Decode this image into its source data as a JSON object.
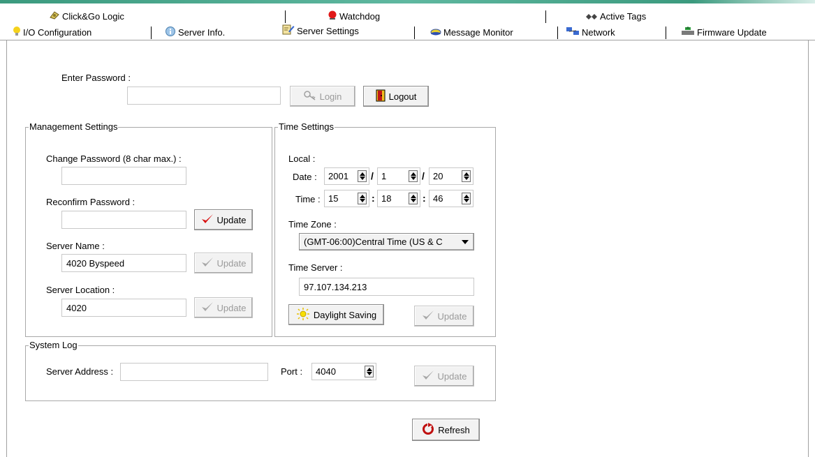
{
  "tabs_row1": [
    {
      "label": "Click&Go Logic",
      "icon": "logic-icon"
    },
    {
      "label": "Watchdog",
      "icon": "watchdog-icon"
    },
    {
      "label": "Active Tags",
      "icon": "active-tags-icon"
    }
  ],
  "tabs_row2": [
    {
      "label": "I/O Configuration",
      "icon": "lightbulb-icon"
    },
    {
      "label": "Server Info.",
      "icon": "info-icon"
    },
    {
      "label": "Server Settings",
      "icon": "settings-pencil-icon"
    },
    {
      "label": "Message Monitor",
      "icon": "message-icon"
    },
    {
      "label": "Network",
      "icon": "network-icon"
    },
    {
      "label": "Firmware Update",
      "icon": "firmware-icon"
    }
  ],
  "active_tab": "Server Settings",
  "login": {
    "password_label": "Enter Password :",
    "password_value": "",
    "login_button": "Login",
    "logout_button": "Logout"
  },
  "management": {
    "title": "Management Settings",
    "change_password_label": "Change Password (8 char max.) :",
    "change_password_value": "",
    "reconfirm_label": "Reconfirm Password :",
    "reconfirm_value": "",
    "server_name_label": "Server Name :",
    "server_name_value": "4020 Byspeed",
    "server_location_label": "Server Location :",
    "server_location_value": "4020",
    "update_label": "Update"
  },
  "time": {
    "title": "Time Settings",
    "local_label": "Local :",
    "date_label": "Date :",
    "date_year": "2001",
    "date_month": "1",
    "date_day": "20",
    "date_sep": "/",
    "time_label": "Time :",
    "time_hour": "15",
    "time_minute": "18",
    "time_second": "46",
    "time_sep": ":",
    "timezone_label": "Time Zone :",
    "timezone_value": "(GMT-06:00)Central Time (US & C",
    "timeserver_label": "Time Server :",
    "timeserver_value": "97.107.134.213",
    "daylight_button": "Daylight Saving",
    "update_label": "Update"
  },
  "syslog": {
    "title": "System Log",
    "server_address_label": "Server Address :",
    "server_address_value": "",
    "port_label": "Port :",
    "port_value": "4040",
    "update_label": "Update"
  },
  "refresh_button": "Refresh",
  "colors": {
    "accent_top": "#3b9a7e",
    "check_red": "#d81010",
    "disabled_text": "#9a9a9a"
  }
}
